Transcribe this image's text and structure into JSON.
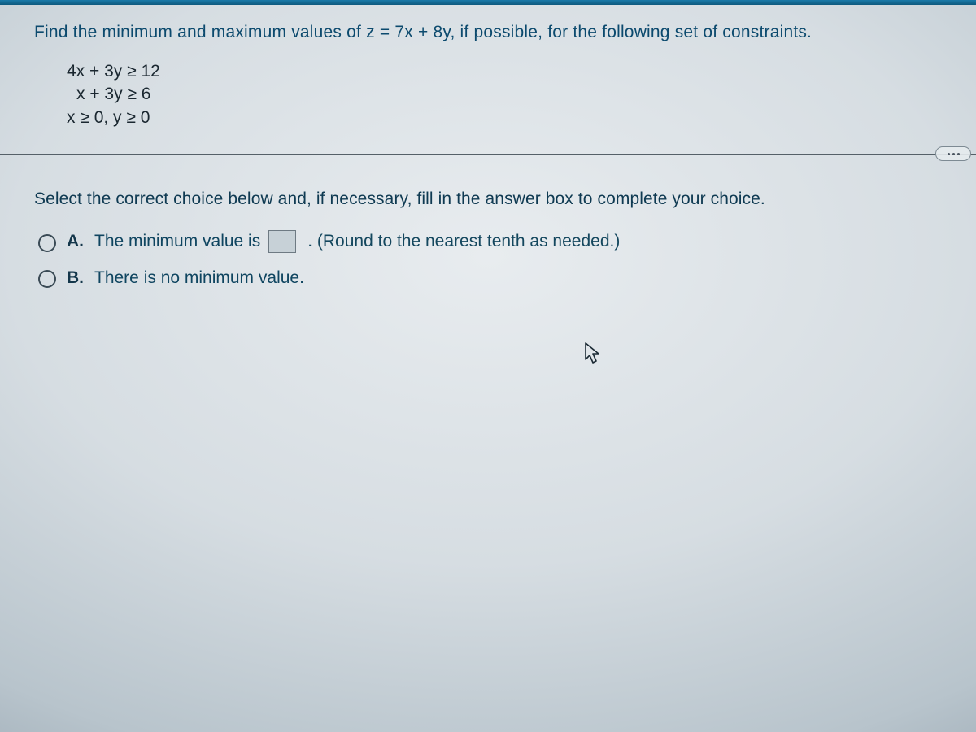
{
  "question": {
    "prompt": "Find the minimum and maximum values of z = 7x + 8y, if possible, for the following set of constraints.",
    "constraints": {
      "line1": "4x + 3y ≥ 12",
      "line2": "x + 3y ≥ 6",
      "line3": "x ≥ 0, y ≥ 0"
    }
  },
  "instruction": "Select the correct choice below and, if necessary, fill in the answer box to complete your choice.",
  "choices": {
    "a": {
      "letter": "A.",
      "text_before": "The minimum value is",
      "answer_value": "",
      "text_after": ". (Round to the nearest tenth as needed.)"
    },
    "b": {
      "letter": "B.",
      "text": "There is no minimum value."
    }
  },
  "more_button_label": "more"
}
